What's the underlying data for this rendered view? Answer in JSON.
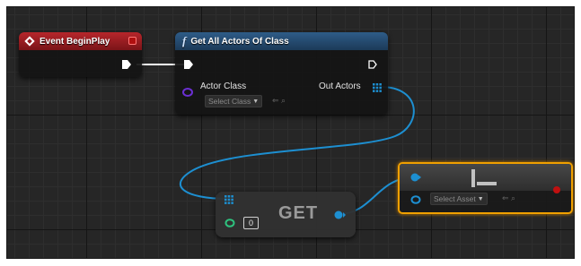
{
  "nodes": {
    "event_beginplay": {
      "title": "Event BeginPlay"
    },
    "get_all_actors": {
      "title": "Get All Actors Of Class",
      "input_label": "Actor Class",
      "input_placeholder": "Select Class",
      "output_label": "Out Actors"
    },
    "get": {
      "title": "GET",
      "index_value": "0"
    },
    "asset": {
      "placeholder": "Select Asset"
    }
  },
  "colors": {
    "event_header": "#b6262b",
    "function_header": "#2e5c88",
    "array_wire": "#1d8fd1",
    "exec_wire": "#ffffff",
    "class_pin": "#6b2fd2",
    "int_pin": "#2ec27e",
    "selection": "#f0a000"
  }
}
